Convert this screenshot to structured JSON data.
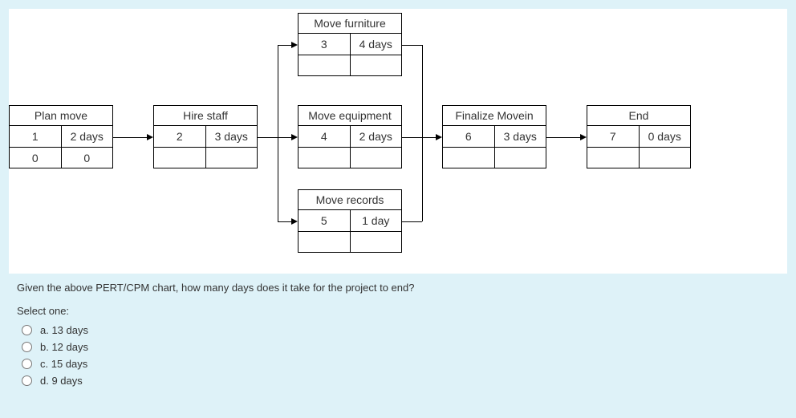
{
  "chart_data": {
    "type": "table",
    "title": "PERT/CPM Chart",
    "series": [
      {
        "name": "Plan move",
        "values": {
          "id": 1,
          "duration_days": 2,
          "es": 0,
          "ef": 0
        }
      },
      {
        "name": "Hire staff",
        "values": {
          "id": 2,
          "duration_days": 3
        }
      },
      {
        "name": "Move furniture",
        "values": {
          "id": 3,
          "duration_days": 4
        }
      },
      {
        "name": "Move equipment",
        "values": {
          "id": 4,
          "duration_days": 2
        }
      },
      {
        "name": "Move records",
        "values": {
          "id": 5,
          "duration_days": 1
        }
      },
      {
        "name": "Finalize Movein",
        "values": {
          "id": 6,
          "duration_days": 3
        }
      },
      {
        "name": "End",
        "values": {
          "id": 7,
          "duration_days": 0
        }
      }
    ],
    "edges": [
      [
        1,
        2
      ],
      [
        2,
        3
      ],
      [
        2,
        4
      ],
      [
        2,
        5
      ],
      [
        3,
        6
      ],
      [
        4,
        6
      ],
      [
        5,
        6
      ],
      [
        6,
        7
      ]
    ]
  },
  "nodes": {
    "plan": {
      "title": "Plan move",
      "id": "1",
      "dur": "2 days",
      "es": "0",
      "ef": "0"
    },
    "hire": {
      "title": "Hire staff",
      "id": "2",
      "dur": "3 days"
    },
    "furn": {
      "title": "Move furniture",
      "id": "3",
      "dur": "4 days"
    },
    "equip": {
      "title": "Move equipment",
      "id": "4",
      "dur": "2 days"
    },
    "rec": {
      "title": "Move records",
      "id": "5",
      "dur": "1 day"
    },
    "fin": {
      "title": "Finalize Movein",
      "id": "6",
      "dur": "3 days"
    },
    "end": {
      "title": "End",
      "id": "7",
      "dur": "0 days"
    }
  },
  "question": {
    "text": "Given the above PERT/CPM chart, how many days does it take for the project to end?",
    "stem": "Select one:",
    "options": {
      "a": "a. 13 days",
      "b": "b. 12 days",
      "c": "c. 15 days",
      "d": "d. 9 days"
    }
  }
}
